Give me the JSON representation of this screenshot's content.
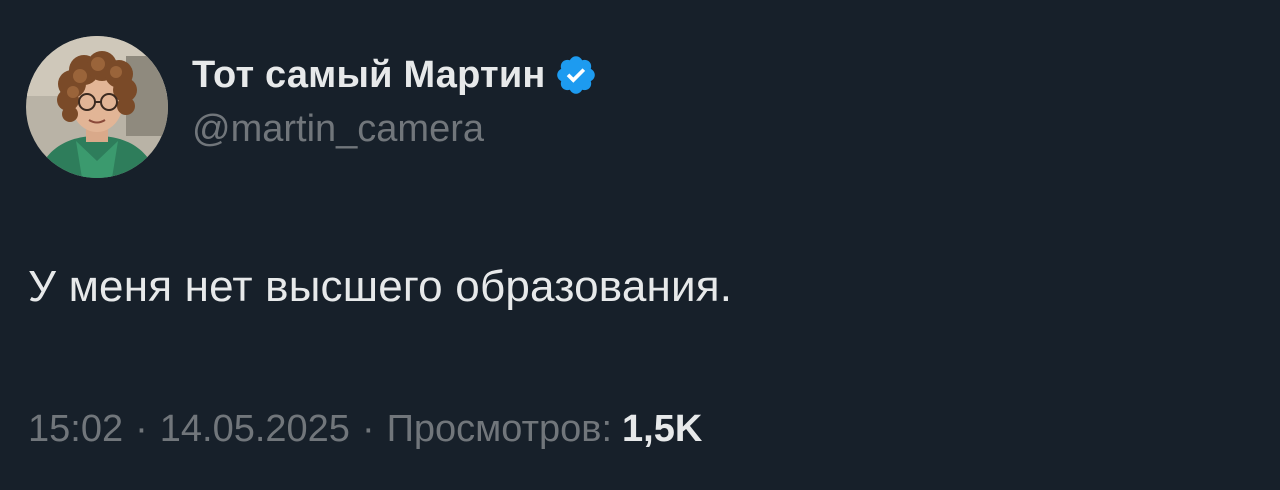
{
  "author": {
    "display_name": "Тот самый Мартин",
    "handle": "@martin_camera",
    "verified": true,
    "verified_badge_color": "#1d9bf0"
  },
  "tweet": {
    "text": "У меня нет высшего образования."
  },
  "meta": {
    "time": "15:02",
    "separator": "·",
    "date": "14.05.2025",
    "views_label": "Просмотров:",
    "views_count": "1,5K"
  },
  "colors": {
    "background": "#17202a",
    "primary_text": "#e7e9ea",
    "secondary_text": "#71767b"
  }
}
